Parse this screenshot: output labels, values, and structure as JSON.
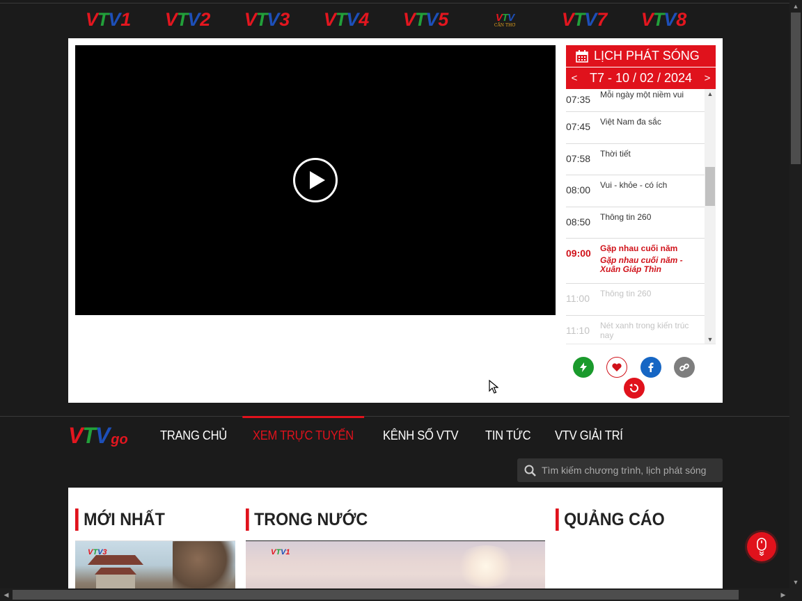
{
  "channels": [
    {
      "prefix": "VTV",
      "num": "1"
    },
    {
      "prefix": "VTV",
      "num": "2"
    },
    {
      "prefix": "VTV",
      "num": "3"
    },
    {
      "prefix": "VTV",
      "num": "4"
    },
    {
      "prefix": "VTV",
      "num": "5"
    },
    {
      "prefix": "VTV",
      "num": "",
      "sub": "CẦN THƠ"
    },
    {
      "prefix": "VTV",
      "num": "7"
    },
    {
      "prefix": "VTV",
      "num": "8"
    }
  ],
  "schedule": {
    "title": "LỊCH PHÁT SÓNG",
    "date": "T7 - 10 / 02 / 2024",
    "prev": "<",
    "next": ">",
    "items": [
      {
        "time": "07:35",
        "name": "Mỗi ngày một niềm vui"
      },
      {
        "time": "07:45",
        "name": "Việt Nam đa sắc"
      },
      {
        "time": "07:58",
        "name": "Thời tiết"
      },
      {
        "time": "08:00",
        "name": "Vui - khỏe - có ích"
      },
      {
        "time": "08:50",
        "name": "Thông tin 260"
      },
      {
        "time": "09:00",
        "name": "Gặp nhau cuối năm",
        "sub": "Gặp nhau cuối năm - Xuân Giáp Thìn"
      },
      {
        "time": "11:00",
        "name": "Thông tin 260"
      },
      {
        "time": "11:10",
        "name": "Nét xanh trong kiến trúc nay"
      }
    ]
  },
  "brand": {
    "name": "VTV",
    "suffix": "go"
  },
  "nav": [
    {
      "label": "TRANG CHỦ"
    },
    {
      "label": "XEM TRỰC TUYẾN"
    },
    {
      "label": "KÊNH SỐ VTV"
    },
    {
      "label": "TIN TỨC"
    },
    {
      "label": "VTV GIẢI TRÍ"
    }
  ],
  "search": {
    "placeholder": "Tìm kiếm chương trình, lịch phát sóng"
  },
  "sections": {
    "latest": "MỚI NHẤT",
    "domestic": "TRONG NƯỚC",
    "ads": "QUẢNG CÁO"
  },
  "thumbs": {
    "badge1": "VTV3",
    "badge2": "VTV1"
  },
  "colors": {
    "accent": "#e0121c",
    "background": "#1b1b1b"
  }
}
